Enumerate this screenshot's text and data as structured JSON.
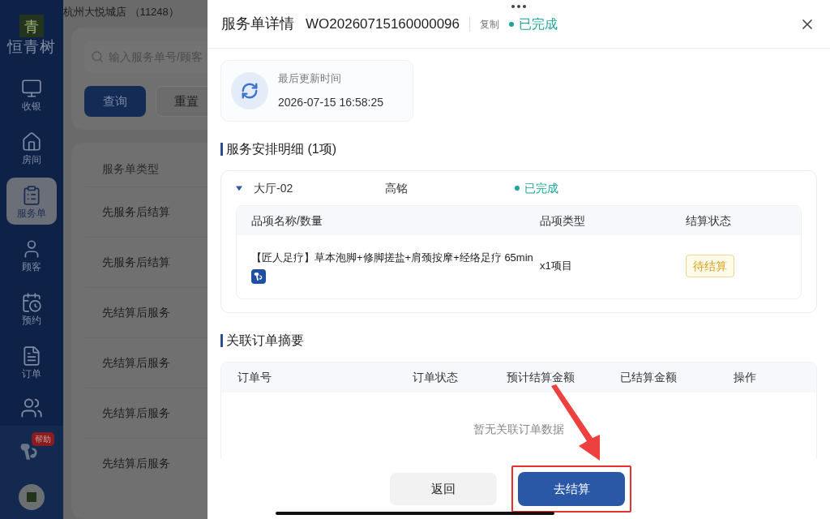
{
  "sidebar": {
    "logo_mark": "青",
    "logo_text": "恒青树",
    "items": [
      {
        "label": "收银",
        "selected": false
      },
      {
        "label": "房间",
        "selected": false
      },
      {
        "label": "服务单",
        "selected": true
      },
      {
        "label": "顾客",
        "selected": false
      },
      {
        "label": "预约",
        "selected": false
      },
      {
        "label": "订单",
        "selected": false
      }
    ],
    "help_badge": "帮助"
  },
  "background": {
    "store": "杭州大悦城店 （11248）",
    "search": {
      "placeholder": "输入服务单号/顾客"
    },
    "buttons": [
      "查询",
      "重置"
    ],
    "table": {
      "columns": [
        "服务单类型"
      ],
      "rows": [
        "先服务后结算",
        "先服务后结算",
        "先结算后服务",
        "先结算后服务",
        "先结算后服务",
        "先结算后服务"
      ]
    }
  },
  "drawer": {
    "title": "服务单详情",
    "order_no": "WO20260715160000096",
    "copy": "复制",
    "status": {
      "label": "已完成",
      "color": "#1aa59a"
    },
    "last_update": {
      "label": "最后更新时间",
      "value": "2026-07-15 16:58:25"
    },
    "arrangement": {
      "title": "服务安排明细 (1项)",
      "groups": [
        {
          "room": "大厅-02",
          "staff": "高铭",
          "status": {
            "label": "已完成",
            "color": "#1aa59a"
          },
          "expanded": true,
          "columns": [
            "品项名称/数量",
            "品项类型",
            "结算状态"
          ],
          "items": [
            {
              "name": "【匠人足疗】草本泡脚+修脚搓盐+肩颈按摩+经络足疗 65min",
              "type": "x1项目",
              "settlement": "待结算"
            }
          ]
        }
      ]
    },
    "orders": {
      "title": "关联订单摘要",
      "columns": [
        "订单号",
        "订单状态",
        "预计结算金额",
        "已结算金额",
        "操作"
      ],
      "empty": "暂无关联订单数据"
    },
    "buttons": {
      "back": "返回",
      "settle": "去结算"
    }
  }
}
